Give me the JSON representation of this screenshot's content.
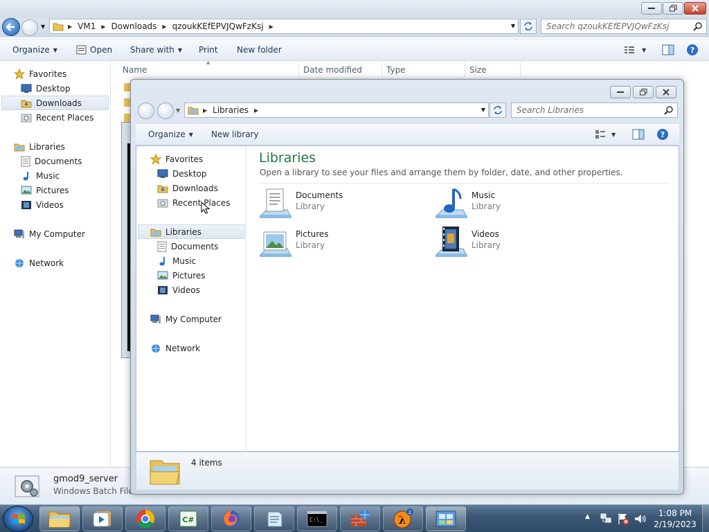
{
  "back_window": {
    "breadcrumb": [
      "VM1",
      "Downloads",
      "qzoukKEfEPVJQwFzKsj"
    ],
    "search_placeholder": "Search qzoukKEfEPVJQwFzKsj",
    "toolbar": {
      "organize": "Organize",
      "open": "Open",
      "share_with": "Share with",
      "print": "Print",
      "new_folder": "New folder"
    },
    "columns": {
      "name": "Name",
      "date_modified": "Date modified",
      "type": "Type",
      "size": "Size"
    },
    "nav": {
      "favorites": "Favorites",
      "desktop": "Desktop",
      "downloads": "Downloads",
      "recent_places": "Recent Places",
      "libraries": "Libraries",
      "documents": "Documents",
      "music": "Music",
      "pictures": "Pictures",
      "videos": "Videos",
      "my_computer": "My Computer",
      "network": "Network"
    },
    "details": {
      "file_name": "gmod9_server",
      "file_type": "Windows Batch File"
    }
  },
  "front_window": {
    "breadcrumb": [
      "Libraries"
    ],
    "search_placeholder": "Search Libraries",
    "toolbar": {
      "organize": "Organize",
      "new_library": "New library"
    },
    "nav": {
      "favorites": "Favorites",
      "desktop": "Desktop",
      "downloads": "Downloads",
      "recent_places": "Recent Places",
      "libraries": "Libraries",
      "documents": "Documents",
      "music": "Music",
      "pictures": "Pictures",
      "videos": "Videos",
      "my_computer": "My Computer",
      "network": "Network"
    },
    "heading": "Libraries",
    "subheading": "Open a library to see your files and arrange them by folder, date, and other properties.",
    "libraries": [
      {
        "name": "Documents",
        "type": "Library",
        "icon": "documents-library-icon"
      },
      {
        "name": "Music",
        "type": "Library",
        "icon": "music-library-icon"
      },
      {
        "name": "Pictures",
        "type": "Library",
        "icon": "pictures-library-icon"
      },
      {
        "name": "Videos",
        "type": "Library",
        "icon": "videos-library-icon"
      }
    ],
    "status": "4 items"
  },
  "taskbar": {
    "apps": [
      "windows-explorer",
      "media-player",
      "chrome",
      "csharp-editor",
      "firefox",
      "notepad",
      "command-prompt",
      "firewall",
      "half-life-2",
      "control-panel"
    ],
    "time": "1:08 PM",
    "date": "2/19/2023"
  },
  "colors": {
    "heading": "#1e7a3c",
    "taskbar": "#3b5673",
    "selection": "#dde6f1"
  }
}
